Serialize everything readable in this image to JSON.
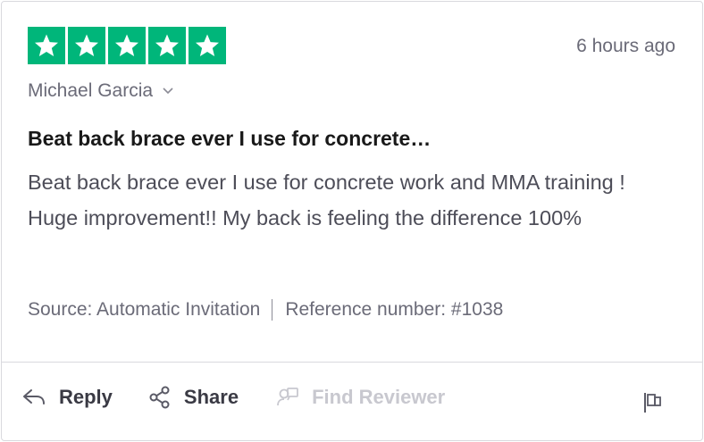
{
  "review": {
    "rating": 5,
    "rating_color": "#00b67a",
    "time_ago": "6 hours ago",
    "reviewer_name": "Michael Garcia",
    "title": "Beat back brace ever I use for concrete…",
    "body": "Beat back brace ever I use for concrete work and MMA training ! Huge improvement!! My back is feeling the difference 100%",
    "source": "Source: Automatic Invitation",
    "reference": "Reference number: #1038"
  },
  "actions": {
    "reply_label": "Reply",
    "share_label": "Share",
    "find_reviewer_label": "Find Reviewer"
  },
  "icons": [
    "star-icon",
    "chevron-down-icon",
    "reply-icon",
    "share-icon",
    "find-reviewer-icon",
    "flag-icon"
  ]
}
